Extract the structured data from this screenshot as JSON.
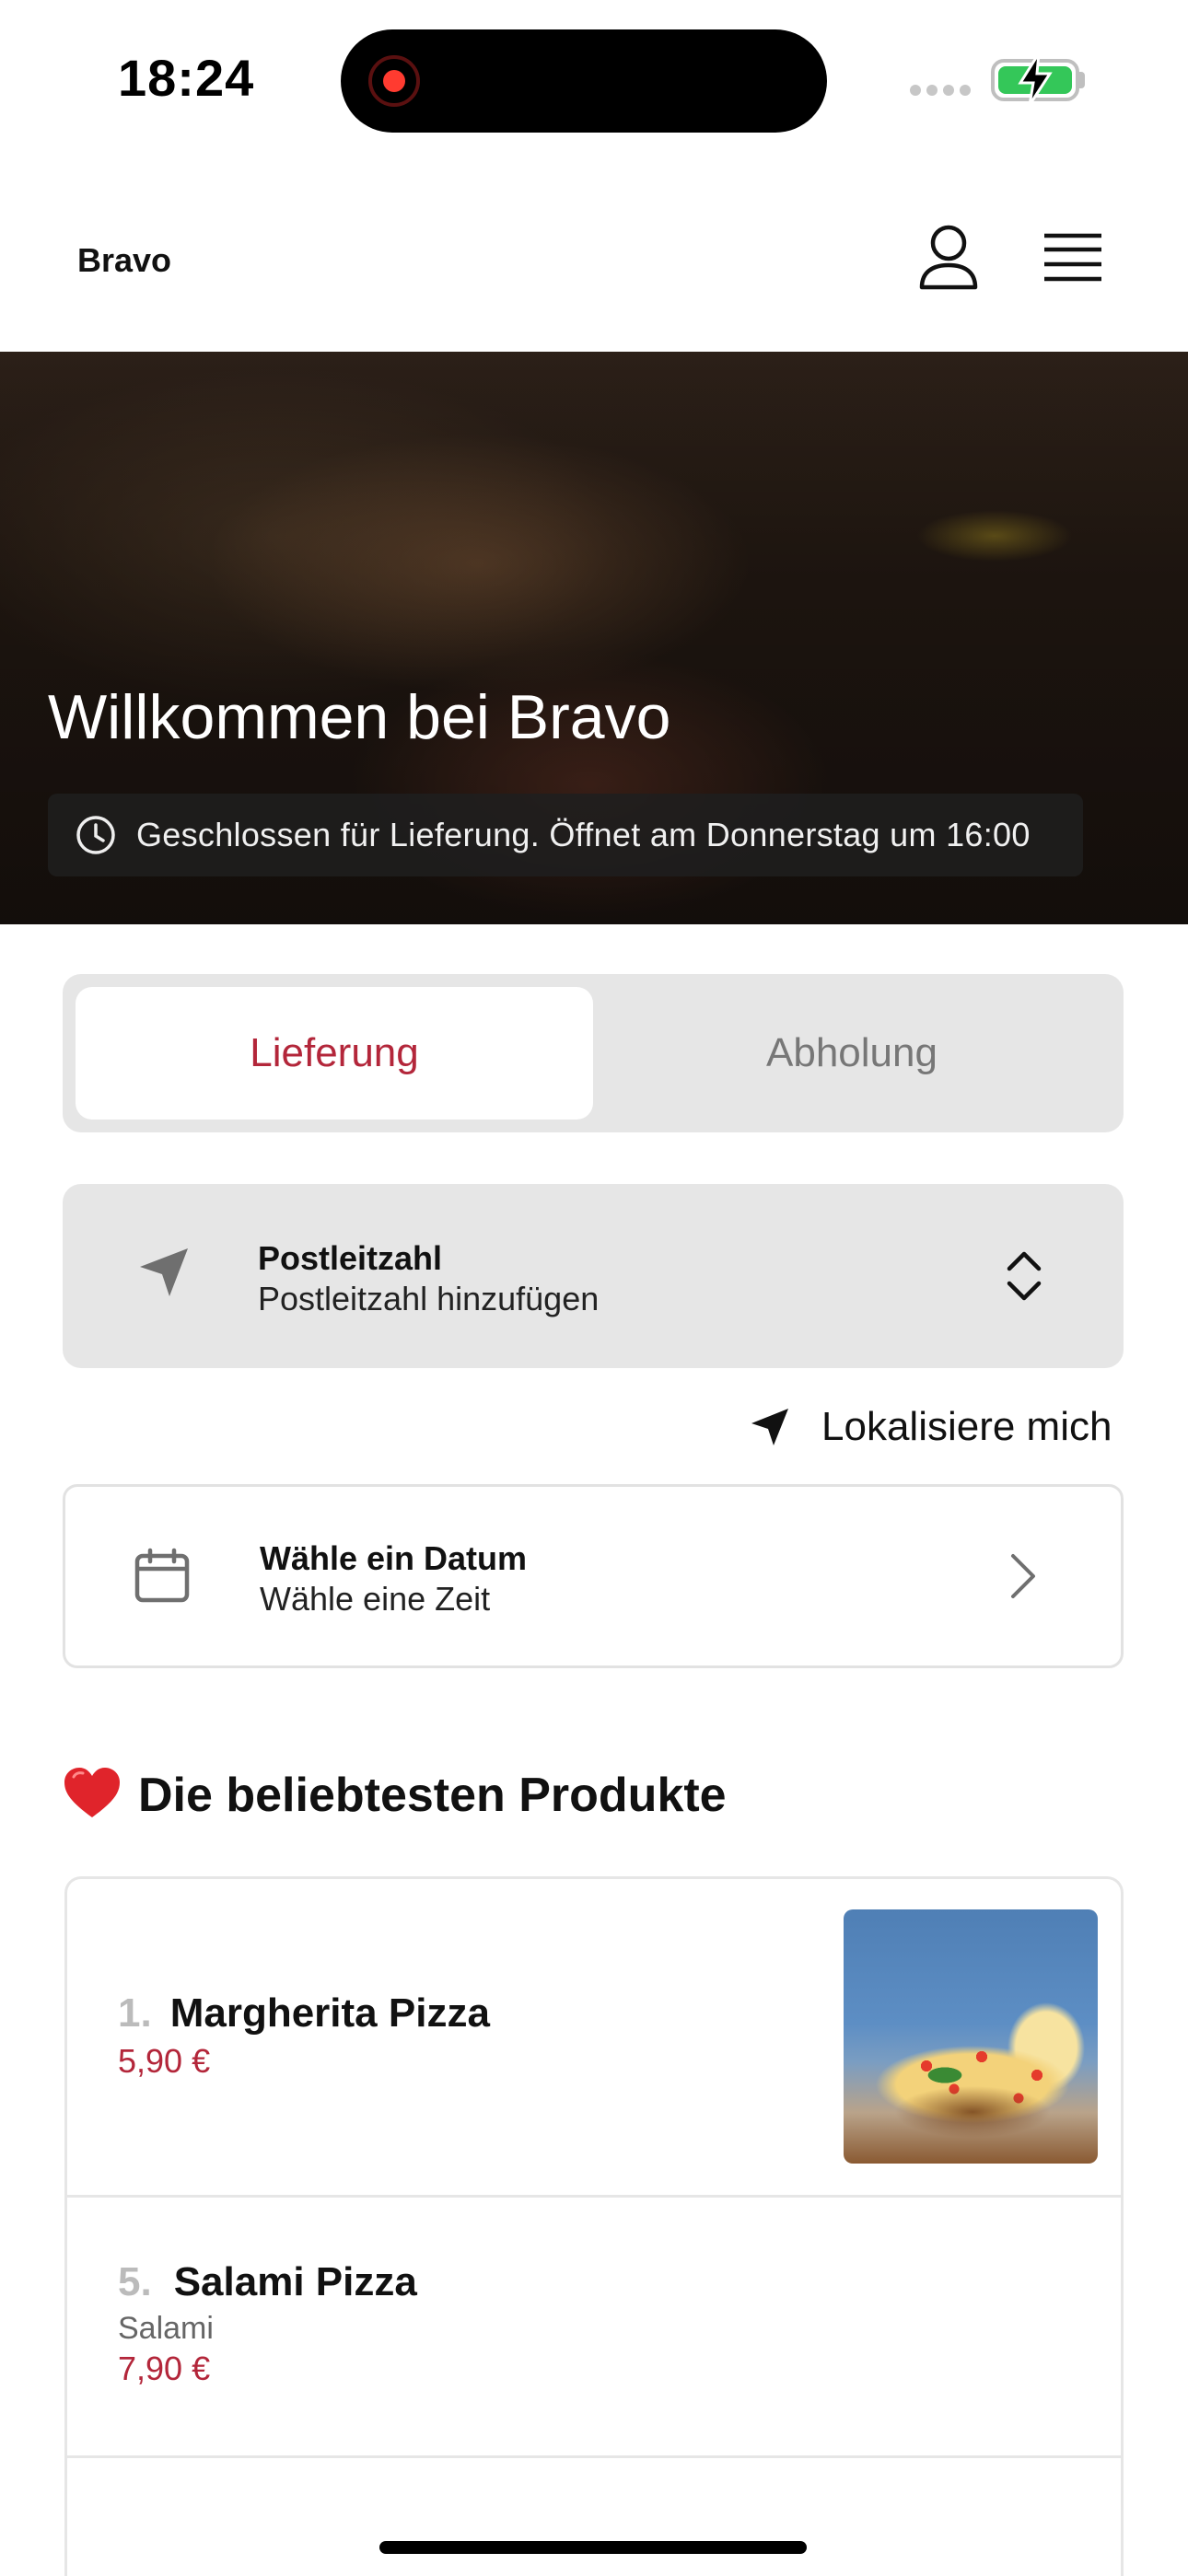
{
  "status_bar": {
    "time": "18:24"
  },
  "header": {
    "brand": "Bravo"
  },
  "hero": {
    "title": "Willkommen bei Bravo",
    "notice": "Geschlossen für Lieferung. Öffnet am Donnerstag um 16:00"
  },
  "order_mode": {
    "tabs": [
      "Lieferung",
      "Abholung"
    ],
    "selected": "Lieferung"
  },
  "postcode": {
    "label": "Postleitzahl",
    "placeholder": "Postleitzahl hinzufügen"
  },
  "locate": {
    "label": "Lokalisiere mich"
  },
  "schedule": {
    "date_label": "Wähle ein Datum",
    "time_label": "Wähle eine Zeit"
  },
  "popular": {
    "title": "Die beliebtesten Produkte",
    "items": [
      {
        "rank": "1.",
        "name": "Margherita Pizza",
        "desc": "",
        "price": "5,90 €"
      },
      {
        "rank": "5.",
        "name": "Salami Pizza",
        "desc": "Salami",
        "price": "7,90 €"
      }
    ]
  },
  "colors": {
    "accent": "#b3263a",
    "segment_bg": "#e6e6e6",
    "card_border": "#e2e2e2"
  },
  "icons": [
    "user-icon",
    "menu-icon",
    "clock-icon",
    "location-arrow-icon",
    "chevron-up-down-icon",
    "navigation-arrow-icon",
    "calendar-icon",
    "chevron-right-icon",
    "heart-icon"
  ]
}
